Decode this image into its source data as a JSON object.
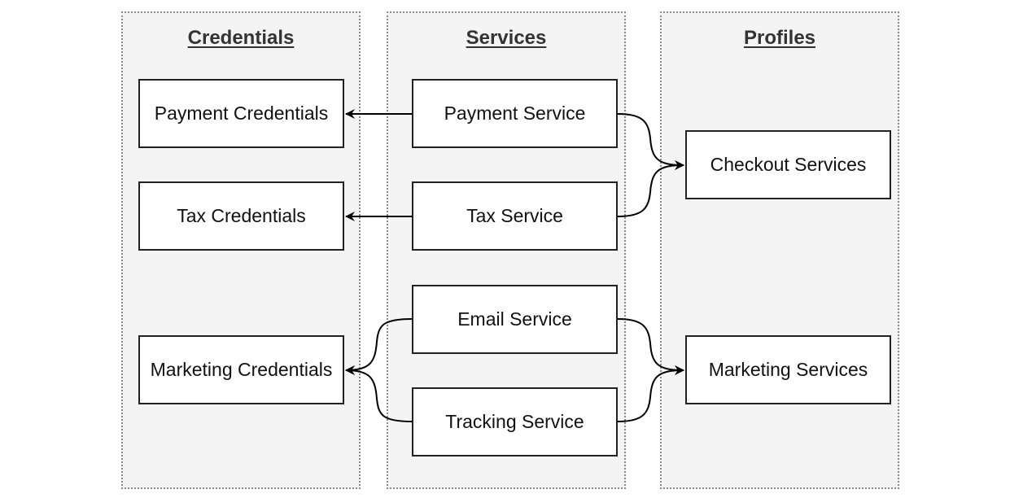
{
  "lanes": [
    {
      "id": "credentials",
      "title": "Credentials"
    },
    {
      "id": "services",
      "title": "Services"
    },
    {
      "id": "profiles",
      "title": "Profiles"
    }
  ],
  "nodes": {
    "payment_credentials": "Payment Credentials",
    "tax_credentials": "Tax Credentials",
    "marketing_credentials": "Marketing Credentials",
    "payment_service": "Payment Service",
    "tax_service": "Tax Service",
    "email_service": "Email Service",
    "tracking_service": "Tracking Service",
    "checkout_services": "Checkout Services",
    "marketing_services": "Marketing Services"
  },
  "edges": [
    {
      "from": "payment_service",
      "to": "payment_credentials"
    },
    {
      "from": "tax_service",
      "to": "tax_credentials"
    },
    {
      "from": "email_service",
      "to": "marketing_credentials"
    },
    {
      "from": "tracking_service",
      "to": "marketing_credentials"
    },
    {
      "from": "payment_service",
      "to": "checkout_services"
    },
    {
      "from": "tax_service",
      "to": "checkout_services"
    },
    {
      "from": "email_service",
      "to": "marketing_services"
    },
    {
      "from": "tracking_service",
      "to": "marketing_services"
    }
  ],
  "colors": {
    "lane_fill": "#f4f4f4",
    "lane_border": "#8a8a8a",
    "node_border": "#222222",
    "edge": "#000000"
  }
}
